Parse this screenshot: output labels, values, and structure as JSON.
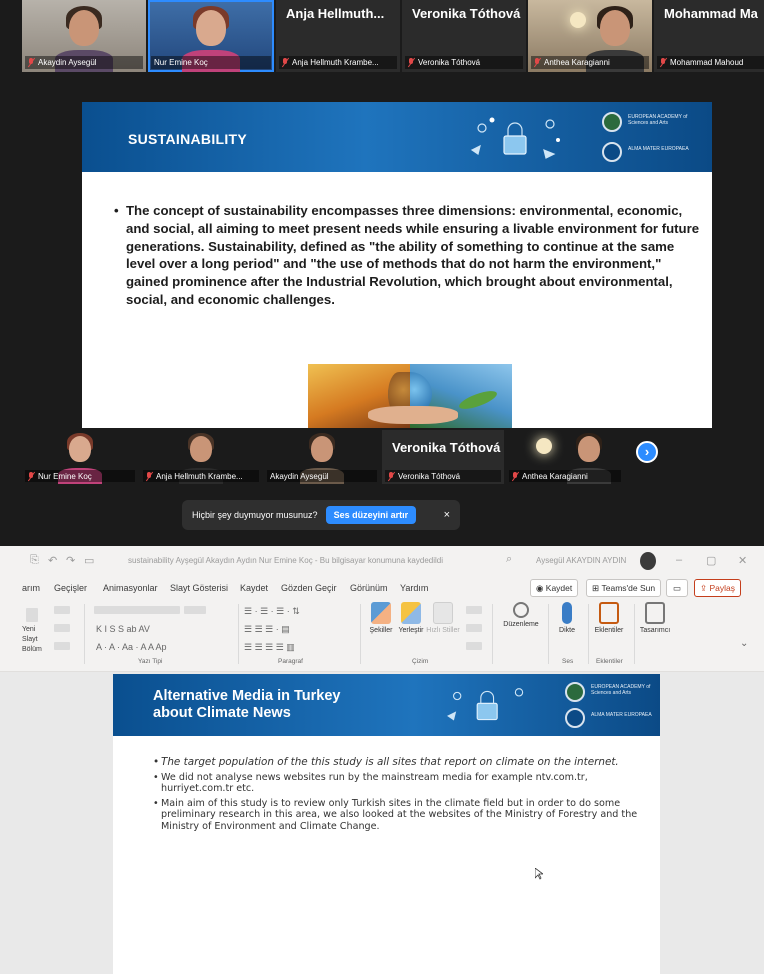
{
  "zoom": {
    "top_gallery": [
      {
        "label": "Akaydin Aysegül",
        "name": ""
      },
      {
        "label": "Nur Emine Koç",
        "name": ""
      },
      {
        "label": "Anja Hellmuth Krambe...",
        "name": "Anja Hellmuth..."
      },
      {
        "label": "Veronika Tóthová",
        "name": "Veronika Tóthová"
      },
      {
        "label": "Anthea Karagianni",
        "name": ""
      },
      {
        "label": "Mohammad Mahoud",
        "name": "Mohammad Ma"
      }
    ],
    "bottom_gallery": [
      {
        "label": "Nur Emine Koç",
        "name": ""
      },
      {
        "label": "Anja Hellmuth Krambe...",
        "name": ""
      },
      {
        "label": "Akaydin Aysegül",
        "name": ""
      },
      {
        "label": "Veronika Tóthová",
        "name": "Veronika Tóthová"
      },
      {
        "label": "Anthea Karagianni",
        "name": ""
      }
    ],
    "next_icon": "chevron-right-icon",
    "audio_prompt": {
      "text": "Hiçbir şey duymuyor musunuz?",
      "button": "Ses düzeyini artır",
      "close": "×"
    }
  },
  "shared_slide": {
    "title": "SUSTAINABILITY",
    "logo_top": "EUROPEAN ACADEMY of Sciences and Arts",
    "logo_bottom": "ALMA MATER EUROPAEA",
    "bullet": "The concept of sustainability encompasses three dimensions: environmental, economic, and social, all aiming to meet present needs while ensuring a livable environment for future generations. Sustainability, defined as \"the ability of something to continue at the same level over a long period\" and \"the use of methods that do not harm the environment,\" gained prominence after the Industrial Revolution, which brought about environmental, social, and economic challenges."
  },
  "powerpoint": {
    "titlebar": {
      "document": "sustainability Ayşegül Akaydın Aydın Nur Emine Koç - Bu bilgisayar konumuna kaydedildi",
      "search": "",
      "user": "Aysegül AKAYDIN AYDIN"
    },
    "tabs": [
      "arım",
      "Geçişler",
      "Animasyonlar",
      "Slayt Gösterisi",
      "Kaydet",
      "Gözden Geçir",
      "Görünüm",
      "Yardım"
    ],
    "actions": {
      "record": "Kaydet",
      "teams": "Teams'de Sun",
      "share": "Paylaş"
    },
    "ribbon": {
      "left_labels": [
        "Yeni",
        "Slayt",
        "Bölüm"
      ],
      "groups": [
        "Yazı Tipi",
        "Paragraf",
        "Çizim",
        "Ses",
        "Eklentiler"
      ],
      "buttons": [
        "Şekiller",
        "Yerleştir",
        "Hızlı Stiller",
        "Düzenleme",
        "Dikte",
        "Eklentiler",
        "Tasarımcı"
      ]
    },
    "slide": {
      "title_line1": "Alternative Media in Turkey",
      "title_line2": "about Climate News",
      "bullets": [
        "The target population of the this study is all sites that report on climate on the internet.",
        "We did not analyse news websites run by the mainstream media for example ntv.com.tr, hurriyet.com.tr etc.",
        "Main aim of this study is to review only Turkish sites in the climate field but in order to do some preliminary research in this area, we also looked at the websites of the Ministry of Forestry and the Ministry of Environment and Climate Change."
      ]
    }
  }
}
